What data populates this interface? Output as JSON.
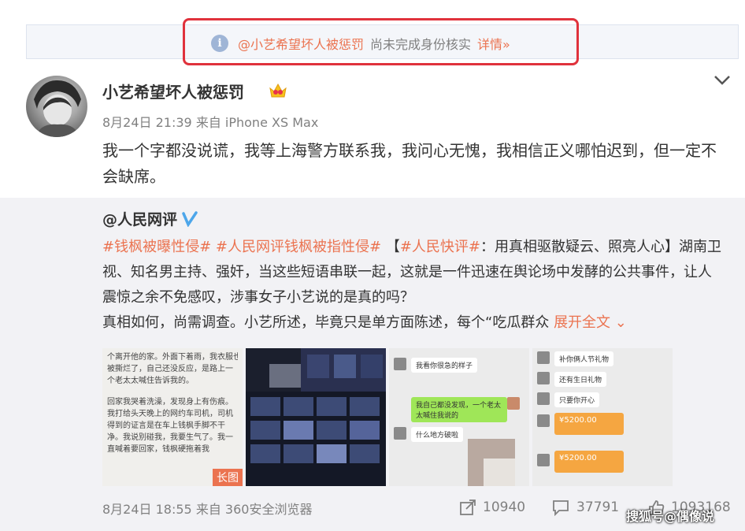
{
  "notice": {
    "user": "@小艺希望坏人被惩罚",
    "text": "尚未完成身份核实",
    "link": "详情»",
    "icon": "info-icon"
  },
  "post": {
    "username": "小艺希望坏人被惩罚",
    "time": "8月24日 21:39 来自 iPhone XS Max",
    "text": "我一个字都没说谎，我等上海警方联系我，我问心无愧，我相信正义哪怕迟到，但一定不会缺席。"
  },
  "repost": {
    "author": "@人民网评",
    "tag1": "#钱枫被曝性侵#",
    "tag2": "#人民网评钱枫被指性侵#",
    "bracket_open": "【",
    "tag3": "#人民快评#",
    "text_a": "：用真相驱散疑云、照亮人心】湖南卫视、知名男主持、强奸，当这些短语串联一起，这就是一件迅速在舆论场中发酵的公共事件，让人震惊之余不免感叹，涉事女子小艺说的是真的吗？",
    "text_b": "真相如何，尚需调查。小艺所述，毕竟只是单方面陈述，每个“吃瓜群众",
    "expand": "展开全文",
    "thumb1_lines": [
      "个离开他的家。外面下着雨，我衣服也",
      "被撕烂了，自己还没反应，是路上一",
      "个老太太喊住告诉我的。",
      "",
      "回家我哭着洗澡，发现身上有伤痕。",
      "我打给头天晚上的网约车司机，司机",
      "得到的证言是在车上钱枫手脚不干",
      "净。我说别碰我，我要生气了。我一",
      "直喊着要回家，钱枫硬拖着我"
    ],
    "thumb1_badge": "长图",
    "thumb3_msgs": [
      "我看你很急的样子",
      "我自己都没发现，一个老太太喊住我说的",
      "什么地方破啦"
    ],
    "thumb4_msgs": [
      "补你俩人节礼物",
      "还有生日礼物",
      "只要你开心"
    ],
    "thumb4_amount": "¥5200.00",
    "time": "8月24日 18:55 来自 360安全浏览器",
    "reposts": "10940",
    "comments": "37791",
    "likes": "1093168"
  },
  "watermark": "搜狐号@偶像说",
  "colors": {
    "accent": "#eb7350",
    "gray": "#808080",
    "outline": "#e0323c"
  }
}
